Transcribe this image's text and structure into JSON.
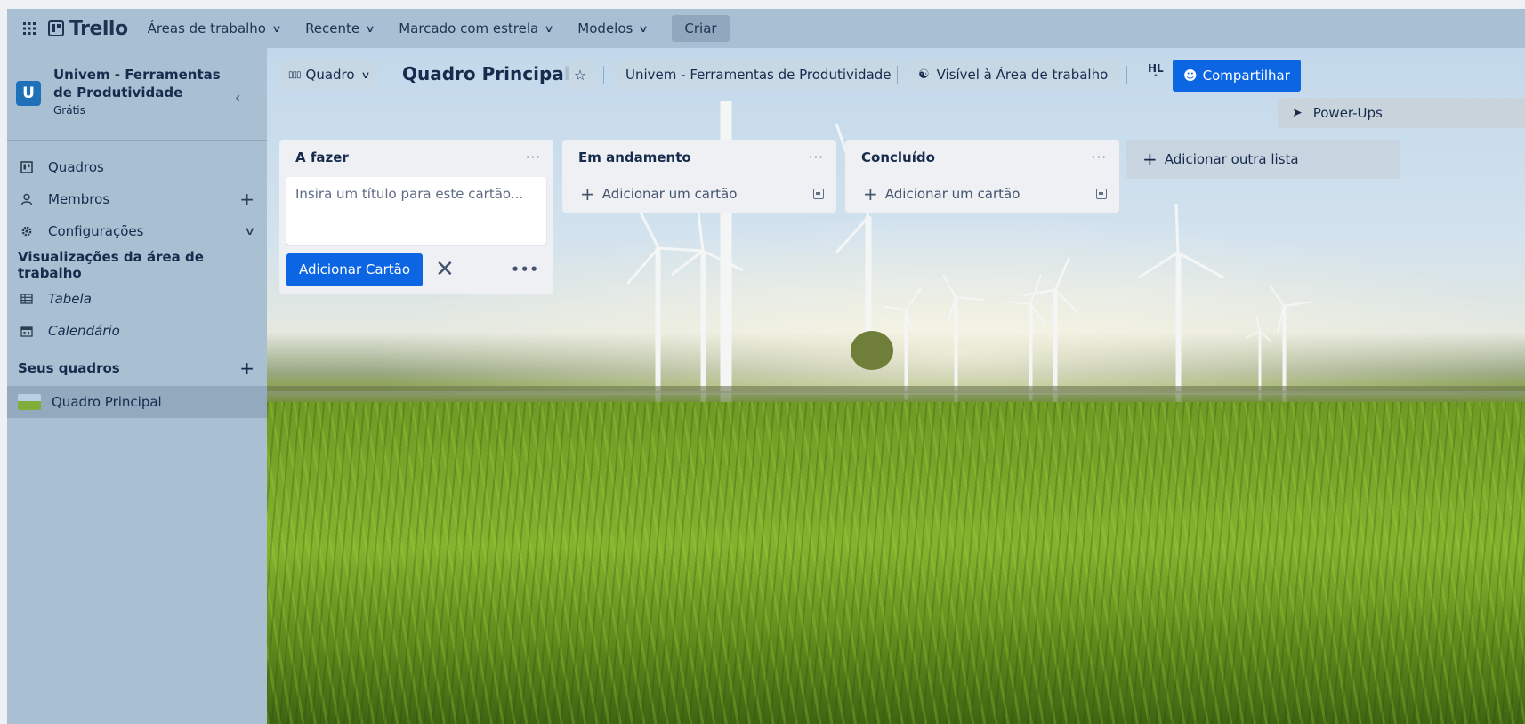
{
  "topnav": {
    "logo": "Trello",
    "items": [
      {
        "label": "Áreas de trabalho"
      },
      {
        "label": "Recente"
      },
      {
        "label": "Marcado com estrela"
      },
      {
        "label": "Modelos"
      }
    ],
    "create_label": "Criar"
  },
  "sidebar": {
    "workspace_initial": "U",
    "workspace_name": "Univem - Ferramentas de Produtividade",
    "workspace_plan": "Grátis",
    "items": [
      {
        "label": "Quadros",
        "icon": "board-icon"
      },
      {
        "label": "Membros",
        "icon": "person-icon"
      },
      {
        "label": "Configurações",
        "icon": "gear-icon"
      }
    ],
    "views_heading": "Visualizações da área de trabalho",
    "views": [
      {
        "label": "Tabela",
        "icon": "table-icon"
      },
      {
        "label": "Calendário",
        "icon": "calendar-icon"
      }
    ],
    "boards_heading": "Seus quadros",
    "boards": [
      {
        "label": "Quadro Principal"
      }
    ]
  },
  "board": {
    "view_label": "Quadro",
    "title": "Quadro Principal",
    "workspace_label": "Univem - Ferramentas de Produtividade",
    "visibility_label": "Visível à Área de trabalho",
    "member_initials": "HL",
    "share_label": "Compartilhar",
    "powerups_label": "Power-Ups",
    "lists": [
      {
        "title": "A fazer",
        "compose_placeholder": "Insira um título para este cartão...",
        "add_card_button": "Adicionar Cartão"
      },
      {
        "title": "Em andamento",
        "add_card_label": "Adicionar um cartão"
      },
      {
        "title": "Concluído",
        "add_card_label": "Adicionar um cartão"
      }
    ],
    "add_list_label": "Adicionar outra lista"
  },
  "colors": {
    "accent": "#0c66e4",
    "nav_bg": "#a8bfd4",
    "workspace_avatar": "#1e70b8"
  }
}
